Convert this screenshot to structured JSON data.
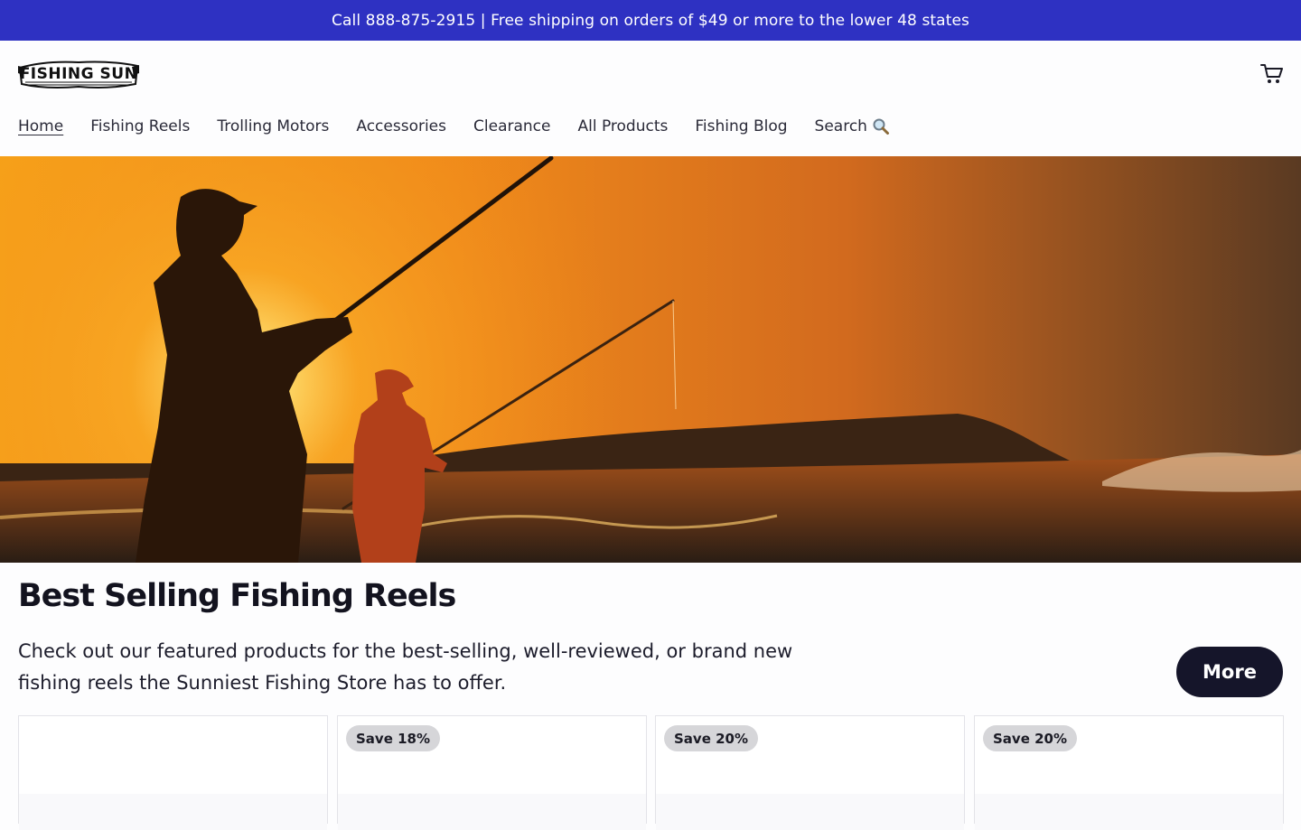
{
  "announcement": {
    "text": "Call 888-875-2915 | Free shipping on orders of $49 or more to the lower 48 states"
  },
  "header": {
    "logo_text": "FISHING SUN",
    "cart_icon": "cart-icon"
  },
  "nav": {
    "items": [
      {
        "label": "Home",
        "active": true
      },
      {
        "label": "Fishing Reels"
      },
      {
        "label": "Trolling Motors"
      },
      {
        "label": "Accessories"
      },
      {
        "label": "Clearance"
      },
      {
        "label": "All Products"
      },
      {
        "label": "Fishing Blog"
      },
      {
        "label": "Search",
        "icon": "magnifier-icon"
      }
    ]
  },
  "hero": {
    "image": "two anglers silhouetted at sunset casting fishing rods into the surf"
  },
  "featured": {
    "title": "Best Selling Fishing Reels",
    "description": "Check out our featured products for the best-selling, well-reviewed, or brand new fishing reels the Sunniest Fishing Store has to offer.",
    "more_label": "More"
  },
  "products": [
    {
      "badge": ""
    },
    {
      "badge": "Save 18%"
    },
    {
      "badge": "Save 20%"
    },
    {
      "badge": "Save 20%"
    }
  ],
  "colors": {
    "announcement_bg": "#2e31c2",
    "button_bg": "#15152a",
    "badge_bg": "#d6d6d9"
  }
}
